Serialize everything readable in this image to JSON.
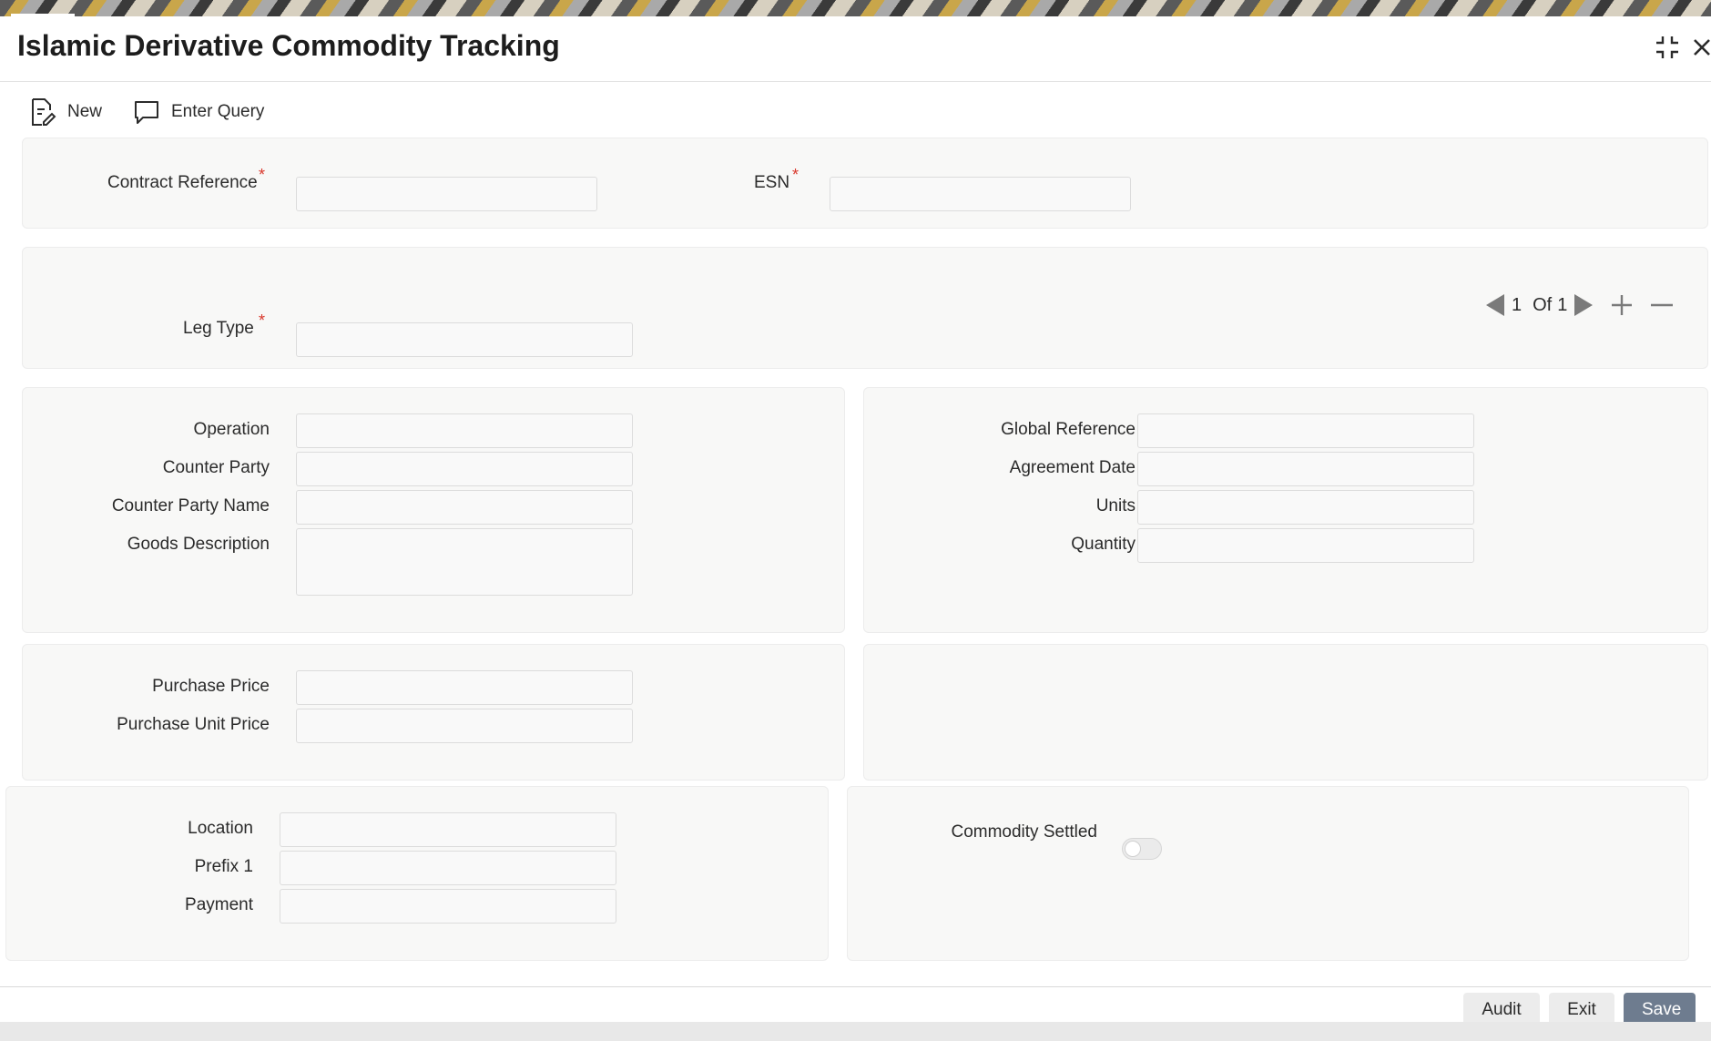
{
  "window": {
    "title": "Islamic Derivative Commodity Tracking"
  },
  "toolbar": {
    "new_label": "New",
    "enter_query_label": "Enter Query"
  },
  "header": {
    "contract_reference_label": "Contract Reference",
    "contract_reference_value": "",
    "esn_label": "ESN",
    "esn_value": "",
    "required_mark": "*"
  },
  "leg": {
    "leg_type_label": "Leg Type",
    "leg_type_value": "",
    "pager": {
      "current": "1",
      "of_label": "Of",
      "total": "1"
    }
  },
  "details_left": {
    "operation_label": "Operation",
    "counter_party_label": "Counter Party",
    "counter_party_name_label": "Counter Party Name",
    "goods_description_label": "Goods Description"
  },
  "details_right": {
    "global_reference_label": "Global Reference",
    "agreement_date_label": "Agreement Date",
    "units_label": "Units",
    "quantity_label": "Quantity"
  },
  "pricing": {
    "purchase_price_label": "Purchase Price",
    "purchase_unit_price_label": "Purchase Unit Price"
  },
  "location_section": {
    "location_label": "Location",
    "prefix1_label": "Prefix 1",
    "payment_label": "Payment"
  },
  "settlement": {
    "commodity_settled_label": "Commodity Settled",
    "commodity_settled_on": false
  },
  "footer": {
    "audit_label": "Audit",
    "exit_label": "Exit",
    "save_label": "Save"
  },
  "colors": {
    "accent_save": "#6e7c8f",
    "required": "#d9382c",
    "panel_bg": "#f8f8f7"
  }
}
